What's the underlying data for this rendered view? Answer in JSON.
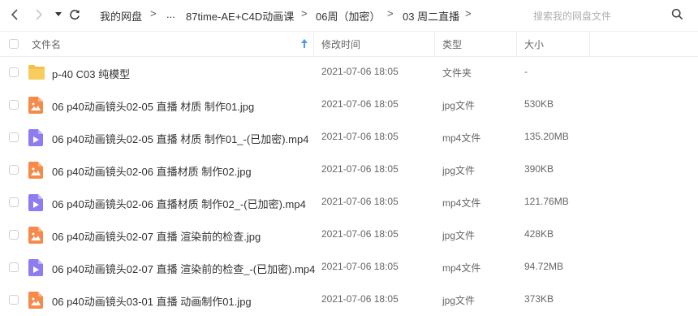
{
  "breadcrumb": {
    "items": [
      "我的网盘",
      "...",
      "87time-AE+C4D动画课",
      "06周（加密）",
      "03 周二直播"
    ],
    "separator": ">"
  },
  "search": {
    "placeholder": "搜索我的网盘文件"
  },
  "table": {
    "columns": [
      "文件名",
      "修改时间",
      "类型",
      "大小"
    ],
    "rows": [
      {
        "name": "p-40 C03 纯模型",
        "time": "2021-07-06 18:05",
        "type": "文件夹",
        "size": "-",
        "icon": "folder-icon"
      },
      {
        "name": "06 p40动画镜头02-05 直播 材质 制作01.jpg",
        "time": "2021-07-06 18:05",
        "type": "jpg文件",
        "size": "530KB",
        "icon": "image-file-icon"
      },
      {
        "name": "06 p40动画镜头02-05 直播 材质 制作01_-(已加密).mp4",
        "time": "2021-07-06 18:05",
        "type": "mp4文件",
        "size": "135.20MB",
        "icon": "video-file-icon"
      },
      {
        "name": "06 p40动画镜头02-06 直播材质 制作02.jpg",
        "time": "2021-07-06 18:05",
        "type": "jpg文件",
        "size": "390KB",
        "icon": "image-file-icon"
      },
      {
        "name": "06 p40动画镜头02-06 直播材质 制作02_-(已加密).mp4",
        "time": "2021-07-06 18:05",
        "type": "mp4文件",
        "size": "121.76MB",
        "icon": "video-file-icon"
      },
      {
        "name": "06 p40动画镜头02-07 直播 渲染前的检查.jpg",
        "time": "2021-07-06 18:05",
        "type": "jpg文件",
        "size": "428KB",
        "icon": "image-file-icon"
      },
      {
        "name": "06 p40动画镜头02-07 直播 渲染前的检查_-(已加密).mp4",
        "time": "2021-07-06 18:05",
        "type": "mp4文件",
        "size": "94.72MB",
        "icon": "video-file-icon"
      },
      {
        "name": "06 p40动画镜头03-01 直播 动画制作01.jpg",
        "time": "2021-07-06 18:05",
        "type": "jpg文件",
        "size": "373KB",
        "icon": "image-file-icon"
      }
    ]
  },
  "colors": {
    "folder": "#f5c04a",
    "image": "#f58a4b",
    "video": "#8f7cf0",
    "sort_arrow": "#4a9be8"
  }
}
